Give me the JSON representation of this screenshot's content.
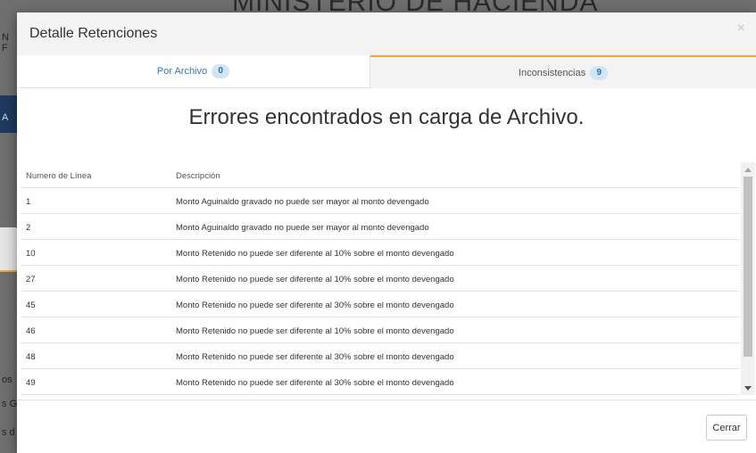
{
  "background": {
    "title_fragment": "MINISTERIO DE HACIENDA",
    "side_letters": [
      "N",
      "F",
      "A",
      "os",
      "s G",
      "s d"
    ]
  },
  "modal": {
    "title": "Detalle Retenciones",
    "close_glyph": "×",
    "tabs": [
      {
        "label": "Por Archivo",
        "count": "0",
        "active": false
      },
      {
        "label": "Inconsistencias",
        "count": "9",
        "active": true
      }
    ],
    "heading": "Errores encontrados en carga de Archivo.",
    "table": {
      "columns": [
        "Numero de Línea",
        "Descripción"
      ],
      "rows": [
        {
          "line": "1",
          "description": "Monto Aguinaldo gravado no puede ser mayor al monto devengado"
        },
        {
          "line": "2",
          "description": "Monto Aguinaldo gravado no puede ser mayor al monto devengado"
        },
        {
          "line": "10",
          "description": "Monto Retenido no puede ser diferente al 10% sobre el monto devengado"
        },
        {
          "line": "27",
          "description": "Monto Retenido no puede ser diferente al 10% sobre el monto devengado"
        },
        {
          "line": "45",
          "description": "Monto Retenido no puede ser diferente al 30% sobre el monto devengado"
        },
        {
          "line": "46",
          "description": "Monto Retenido no puede ser diferente al 10% sobre el monto devengado"
        },
        {
          "line": "48",
          "description": "Monto Retenido no puede ser diferente al 30% sobre el monto devengado"
        },
        {
          "line": "49",
          "description": "Monto Retenido no puede ser diferente al 30% sobre el monto devengado"
        }
      ]
    },
    "close_button_label": "Cerrar"
  },
  "colors": {
    "active_tab_accent": "#f0a830",
    "link_blue": "#337ab7",
    "badge_bg": "#d0e6f5"
  }
}
